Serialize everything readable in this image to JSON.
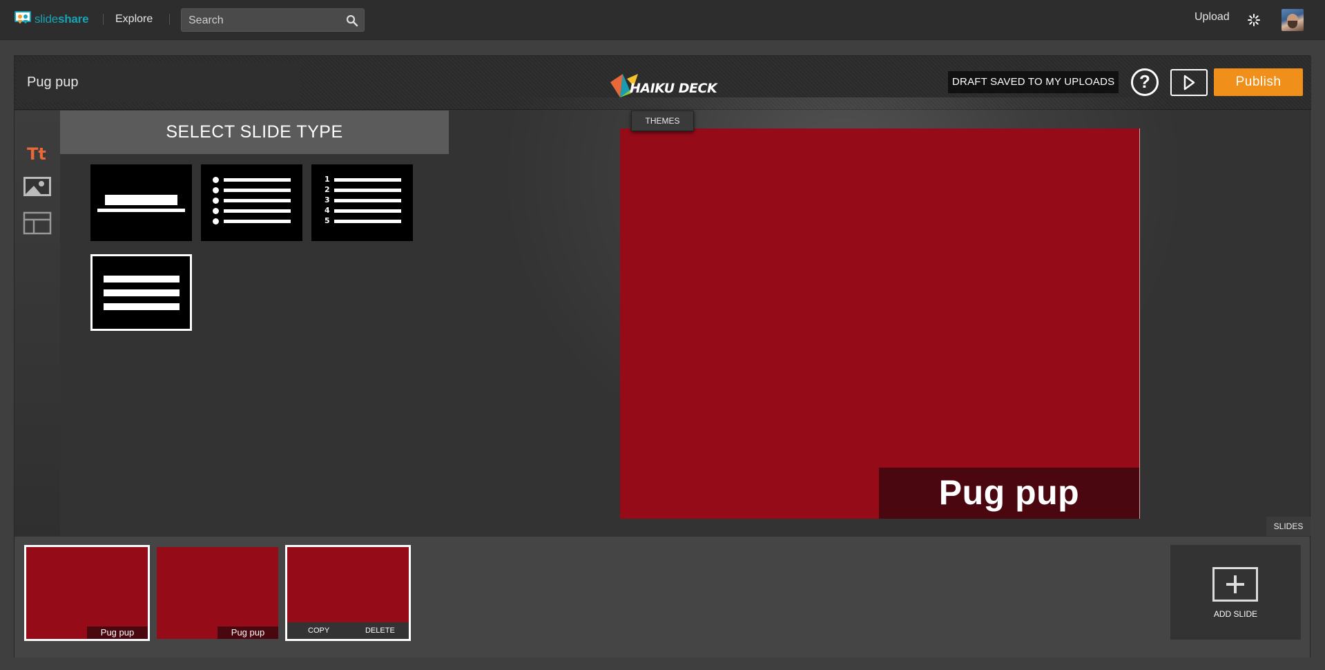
{
  "topbar": {
    "logo_prefix": "slide",
    "logo_suffix": "share",
    "explore": "Explore",
    "search_placeholder": "Search",
    "upload": "Upload"
  },
  "editor": {
    "deck_title": "Pug pup",
    "brand": "HAIKU DECK",
    "draft_status": "DRAFT SAVED TO MY UPLOADS",
    "help": "?",
    "publish": "Publish",
    "themes": "THEMES",
    "select_slide_type": "SELECT SLIDE TYPE",
    "slide_types": [
      "title",
      "bullets",
      "numbered",
      "paragraph"
    ],
    "selected_slide_type": "paragraph",
    "slide_caption": "Pug pup",
    "slides_tab": "SLIDES"
  },
  "rail": {
    "items": [
      "text-icon",
      "image-icon",
      "layout-icon"
    ]
  },
  "numbered_list": [
    "1",
    "2",
    "3",
    "4",
    "5"
  ],
  "slides": [
    {
      "caption": "Pug pup",
      "selected": true
    },
    {
      "caption": "Pug pup",
      "selected": false
    },
    {
      "caption": "",
      "selected": true,
      "actions": [
        "COPY",
        "DELETE"
      ]
    }
  ],
  "add_slide": "ADD SLIDE",
  "colors": {
    "slide_bg": "#950c18",
    "caption_bg": "#4b0710",
    "publish": "#f0901a",
    "brand_teal": "#18a3b5",
    "active_rail": "#e8683a"
  }
}
